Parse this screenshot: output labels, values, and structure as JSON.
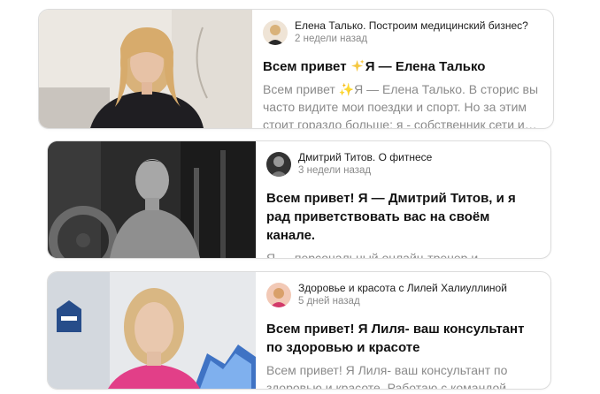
{
  "feed": {
    "cards": [
      {
        "channel": "Елена Талько. Построим медицинский бизнес?",
        "time": "2 недели назад",
        "title_prefix": "Всем привет",
        "title_suffix": "Я — Елена Талько",
        "title_icon": "sparkles-icon",
        "excerpt": "Всем привет ✨Я — Елена Талько. В сторис вы часто видите мои поездки и спорт. Но за этим стоит гораздо больше: я - собственник сети и…"
      },
      {
        "channel": "Дмитрий Титов. О фитнесе",
        "time": "3 недели назад",
        "title": "Всем привет! Я — Дмитрий Титов, и я рад приветствовать вас на своём канале.",
        "excerpt": "Я — персональный онлайн-тренер и нутрициолог, но в первую очередь — я…"
      },
      {
        "channel": "Здоровье и красота с Лилей Халиуллиной",
        "time": "5 дней назад",
        "title": "Всем привет! Я Лиля- ваш консультант по здоровью и красоте",
        "excerpt": "Всем привет! Я Лиля- ваш консультант по здоровью и красоте. Работаю с командой…"
      }
    ]
  },
  "colors": {
    "border": "#dcdcdc",
    "muted_text": "#8a8a8a",
    "title_text": "#111111",
    "sparkle": "#f5c842"
  }
}
